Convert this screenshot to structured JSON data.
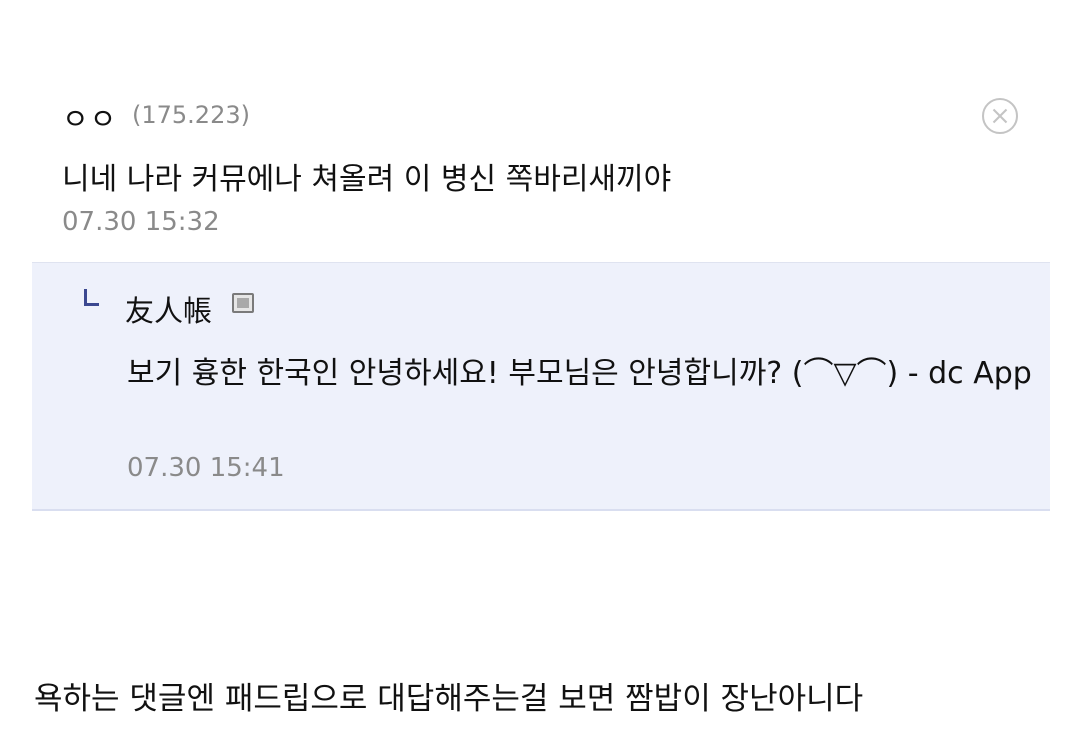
{
  "comment": {
    "author": "ㅇㅇ",
    "ip": "(175.223)",
    "text": "니네 나라 커뮤에나 쳐올려 이 병신 쪽바리새끼야",
    "time": "07.30 15:32",
    "delete_icon": "close-circle-icon"
  },
  "reply": {
    "author": "友人帳",
    "author_badge_icon": "fixed-nick-icon",
    "reply_marker_icon": "reply-arrow-icon",
    "text": "보기 흉한 한국인 안녕하세요! 부모님은 안녕합니까? (⌒▽⌒) - dc App",
    "time": "07.30 15:41",
    "background_color": "#eef1fb"
  },
  "caption": "욕하는 댓글엔 패드립으로 대답해주는걸 보면 짬밥이 장난아니다"
}
